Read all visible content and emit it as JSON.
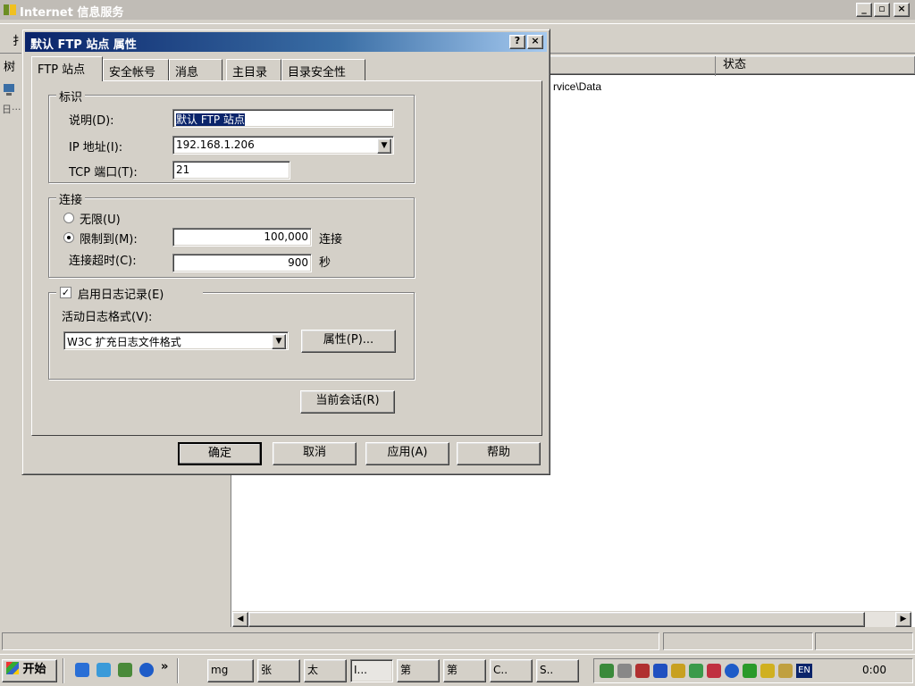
{
  "main_window": {
    "title": "Internet 信息服务",
    "toolbar_fragment": "扌",
    "tree_header": "树",
    "tree_expander": "日···",
    "list_columns": [
      "状态"
    ],
    "path_fragment": "rvice\\Data"
  },
  "dialog": {
    "title": "默认 FTP 站点 属性",
    "help_btn": "?",
    "close_btn": "×",
    "tabs": [
      "FTP 站点",
      "安全帐号",
      "消息",
      "主目录",
      "目录安全性"
    ],
    "ident_group": {
      "legend": "标识",
      "description_label": "说明(D):",
      "description_value": "默认 FTP 站点",
      "ip_label": "IP 地址(I):",
      "ip_value": "192.168.1.206",
      "port_label": "TCP 端口(T):",
      "port_value": "21"
    },
    "conn_group": {
      "legend": "连接",
      "unlimited": "无限(U)",
      "limited": "限制到(M):",
      "limited_value": "100,000",
      "limited_unit": "连接",
      "timeout_label": "连接超时(C):",
      "timeout_value": "900",
      "timeout_unit": "秒"
    },
    "log_group": {
      "enable": "启用日志记录(E)",
      "format_label": "活动日志格式(V):",
      "format_value": "W3C 扩充日志文件格式",
      "properties_btn": "属性(P)..."
    },
    "sessions_btn": "当前会话(R)",
    "ok_btn": "确定",
    "cancel_btn": "取消",
    "apply_btn": "应用(A)",
    "help_button": "帮助"
  },
  "taskbar": {
    "start": "开始",
    "chevron": "»",
    "tasks": [
      "mg",
      "张",
      "太",
      "I...",
      "第",
      "第",
      "C..",
      "S.."
    ],
    "tray_lang": "EN",
    "clock": "0:00"
  },
  "colors": {
    "dialog_title_start": "#0a246a",
    "dialog_title_end": "#a6caf0",
    "face": "#d4d0c8"
  }
}
